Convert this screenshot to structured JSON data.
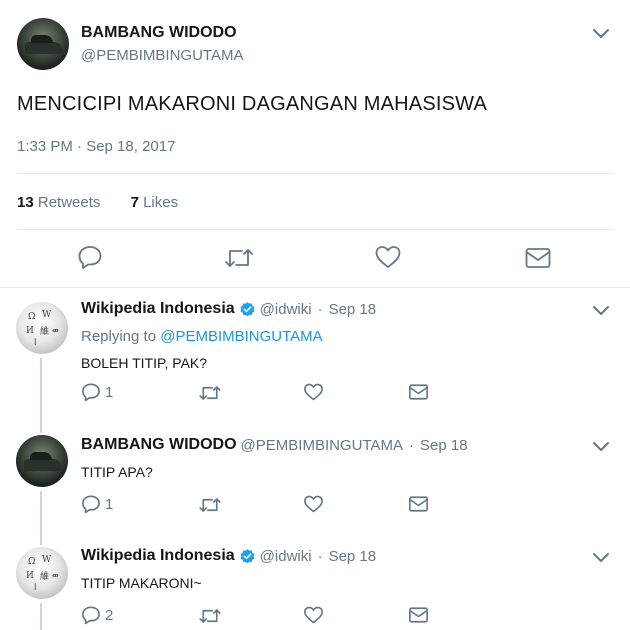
{
  "main_tweet": {
    "author_name": "BAMBANG WIDODO",
    "author_handle": "@PEMBIMBINGUTAMA",
    "text": "MENCICIPI MAKARONI DAGANGAN MAHASISWA",
    "timestamp": "1:33 PM · Sep 18, 2017",
    "retweets_count": "13",
    "retweets_label": "Retweets",
    "likes_count": "7",
    "likes_label": "Likes",
    "actions": [
      "reply-icon",
      "retweet-icon",
      "like-icon",
      "message-icon"
    ]
  },
  "replies": [
    {
      "author_name": "Wikipedia Indonesia",
      "verified": true,
      "author_handle": "@idwiki",
      "separator": "·",
      "date": "Sep 18",
      "replying_label": "Replying to",
      "replying_to": "@PEMBIMBINGUTAMA",
      "text": "BOLEH TITIP, PAK?",
      "reply_count": "1",
      "avatar": "wikipedia-globe"
    },
    {
      "author_name": "BAMBANG WIDODO",
      "verified": false,
      "author_handle": "@PEMBIMBINGUTAMA",
      "separator": "·",
      "date": "Sep 18",
      "text": "TITIP APA?",
      "reply_count": "1",
      "avatar": "car-photo"
    },
    {
      "author_name": "Wikipedia Indonesia",
      "verified": true,
      "author_handle": "@idwiki",
      "separator": "·",
      "date": "Sep 18",
      "text": "TITIP MAKARONI~",
      "reply_count": "2",
      "avatar": "wikipedia-globe"
    }
  ],
  "colors": {
    "text": "#14171a",
    "secondary": "#657786",
    "link": "#1b95e0",
    "verified": "#1da1f2",
    "divider": "#e1e8ed"
  }
}
